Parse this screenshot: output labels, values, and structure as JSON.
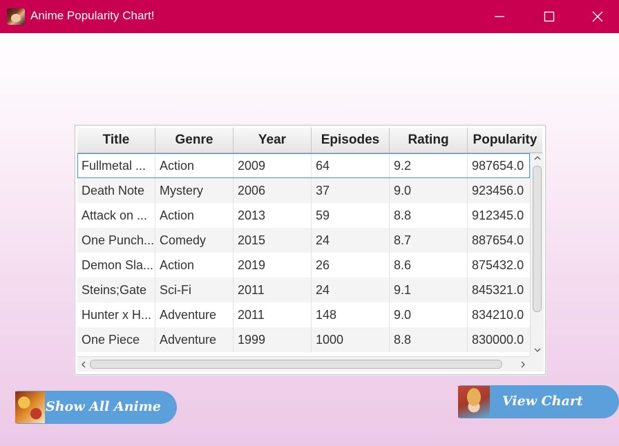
{
  "window": {
    "title": "Anime Popularity Chart!",
    "controls": [
      "minimize-icon",
      "maximize-icon",
      "close-icon"
    ]
  },
  "table": {
    "columns": [
      "Title",
      "Genre",
      "Year",
      "Episodes",
      "Rating",
      "Popularity"
    ],
    "rows": [
      [
        "Fullmetal ...",
        "Action",
        "2009",
        "64",
        "9.2",
        "987654.0"
      ],
      [
        "Death Note",
        "Mystery",
        "2006",
        "37",
        "9.0",
        "923456.0"
      ],
      [
        "Attack on ...",
        "Action",
        "2013",
        "59",
        "8.8",
        "912345.0"
      ],
      [
        "One Punch...",
        "Comedy",
        "2015",
        "24",
        "8.7",
        "887654.0"
      ],
      [
        "Demon Sla...",
        "Action",
        "2019",
        "26",
        "8.6",
        "875432.0"
      ],
      [
        "Steins;Gate",
        "Sci-Fi",
        "2011",
        "24",
        "9.1",
        "845321.0"
      ],
      [
        "Hunter x H...",
        "Adventure",
        "2011",
        "148",
        "9.0",
        "834210.0"
      ],
      [
        "One Piece",
        "Adventure",
        "1999",
        "1000",
        "8.8",
        "830000.0"
      ]
    ],
    "selected_row": 0
  },
  "buttons": {
    "show_all": "Show All Anime",
    "view_chart": "View Chart"
  },
  "colors": {
    "titlebar": "#c8004f",
    "button": "#5b9fdb",
    "selection": "#3d9ad1"
  }
}
